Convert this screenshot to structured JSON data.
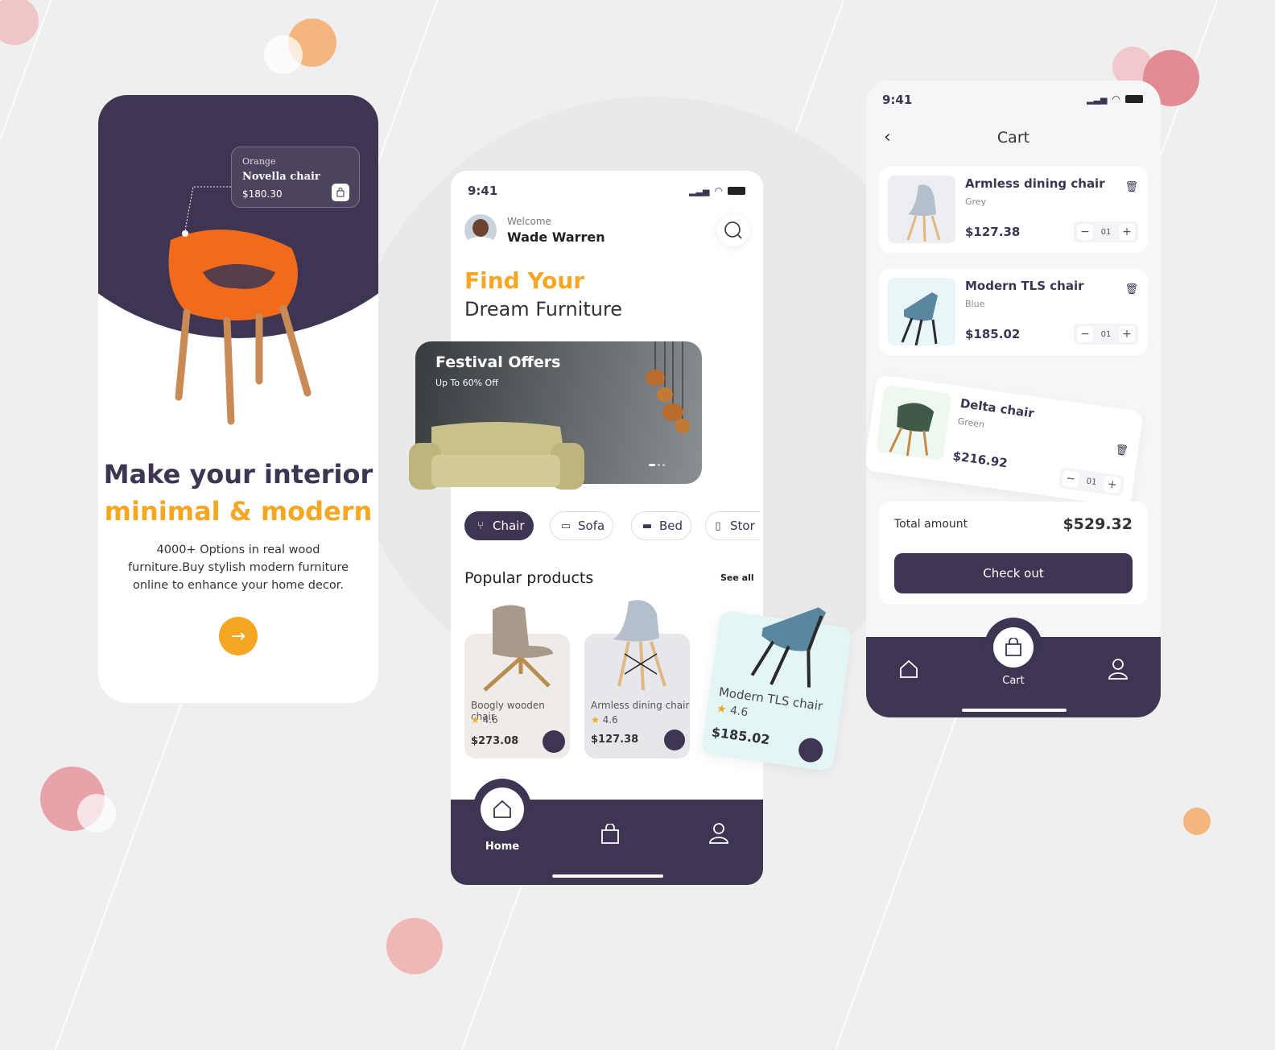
{
  "colors": {
    "primary": "#3d3552",
    "accent": "#f5a623",
    "background": "#efefef"
  },
  "onboarding": {
    "tooltip": {
      "color": "Orange",
      "name": "Novella chair",
      "price": "$180.30",
      "icon": "bag-icon"
    },
    "headline1": "Make your interior",
    "headline2": "minimal & modern",
    "description": "4000+ Options in real wood furniture.Buy stylish modern furniture online to enhance your home decor.",
    "next_icon": "arrow-right-icon"
  },
  "home": {
    "time": "9:41",
    "welcome": "Welcome",
    "user_name": "Wade Warren",
    "title1": "Find Your",
    "title2": "Dream Furniture",
    "banner": {
      "title": "Festival Offers",
      "subtitle": "Up To 60% Off"
    },
    "categories": [
      {
        "label": "Chair",
        "icon": "chair-icon",
        "active": true
      },
      {
        "label": "Sofa",
        "icon": "sofa-icon"
      },
      {
        "label": "Bed",
        "icon": "bed-icon"
      },
      {
        "label": "Stor",
        "icon": "storage-icon"
      }
    ],
    "section_title": "Popular products",
    "see_all": "See all",
    "products": [
      {
        "name": "Boogly wooden chair",
        "rating": "4.6",
        "price": "$273.08"
      },
      {
        "name": "Armless dining chair",
        "rating": "4.6",
        "price": "$127.38"
      },
      {
        "name": "Modern TLS chair",
        "rating": "4.6",
        "price": "$185.02"
      }
    ],
    "nav": {
      "home": "Home"
    }
  },
  "cart": {
    "time": "9:41",
    "title": "Cart",
    "items": [
      {
        "name": "Armless dining chair",
        "color": "Grey",
        "price": "$127.38",
        "qty": "01"
      },
      {
        "name": "Modern TLS chair",
        "color": "Blue",
        "price": "$185.02",
        "qty": "01"
      },
      {
        "name": "Delta chair",
        "color": "Green",
        "price": "$216.92",
        "qty": "01"
      }
    ],
    "total_label": "Total amount",
    "total_value": "$529.32",
    "checkout": "Check out",
    "nav": {
      "cart": "Cart"
    }
  }
}
